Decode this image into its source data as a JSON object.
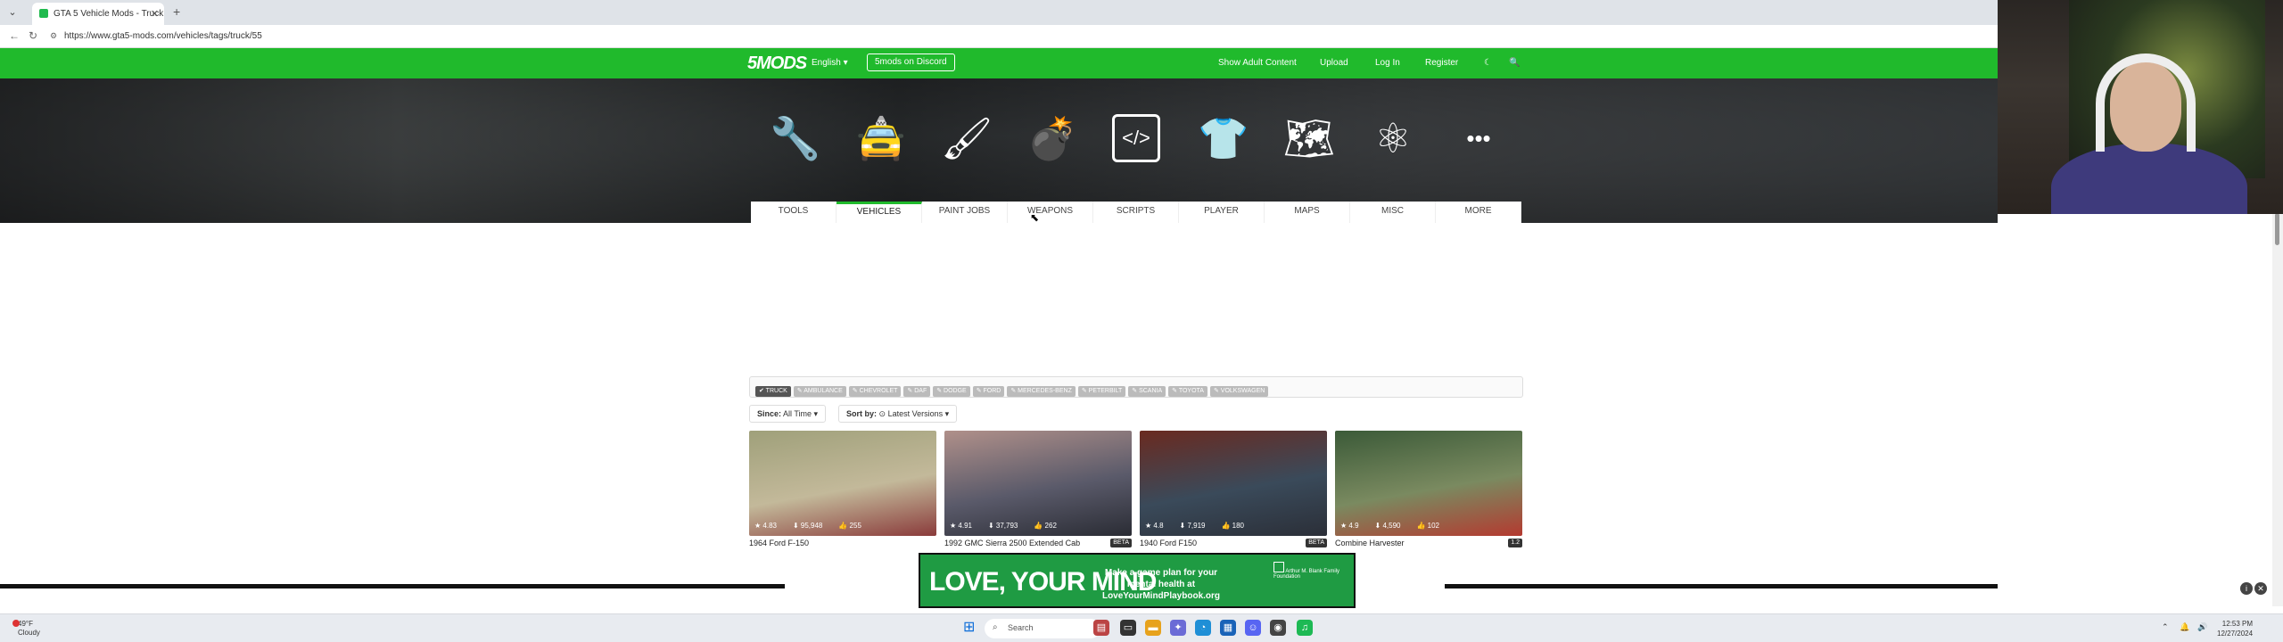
{
  "browser": {
    "tab_title": "GTA 5 Vehicle Mods - Truck - GTA5-",
    "tab_close": "✕",
    "new_tab": "+",
    "url": "https://www.gta5-mods.com/vehicles/tags/truck/55",
    "back": "←",
    "reload": "↻",
    "tab_menu": "⌄"
  },
  "navbar": {
    "logo": "5MODS",
    "language": "English ▾",
    "discord": "5mods on Discord",
    "show_adult": "Show Adult Content",
    "upload": "Upload",
    "login": "Log In",
    "register": "Register",
    "dark_mode_icon": "☾",
    "search_icon": "🔍"
  },
  "categories": [
    {
      "label": "TOOLS",
      "icon": "wrench-screwdriver-icon",
      "glyph": "🔧"
    },
    {
      "label": "VEHICLES",
      "icon": "car-icon",
      "glyph": "🚖",
      "active": true
    },
    {
      "label": "PAINT JOBS",
      "icon": "paint-roller-icon",
      "glyph": "🖌"
    },
    {
      "label": "WEAPONS",
      "icon": "grenade-icon",
      "glyph": "💣"
    },
    {
      "label": "SCRIPTS",
      "icon": "code-icon",
      "glyph": "</>"
    },
    {
      "label": "PLAYER",
      "icon": "hoodie-icon",
      "glyph": "👕"
    },
    {
      "label": "MAPS",
      "icon": "map-icon",
      "glyph": "🗺"
    },
    {
      "label": "MISC",
      "icon": "atom-icon",
      "glyph": "⚛"
    },
    {
      "label": "MORE",
      "icon": "more-dots-icon",
      "glyph": "•••"
    }
  ],
  "filters": [
    "✔ TRUCK",
    "✎ AMBULANCE",
    "✎ CHEVROLET",
    "✎ DAF",
    "✎ DODGE",
    "✎ FORD",
    "✎ MERCEDES-BENZ",
    "✎ PETERBILT",
    "✎ SCANIA",
    "✎ TOYOTA",
    "✎ VOLKSWAGEN"
  ],
  "sort": {
    "since_label": "Since:",
    "since_value": "All Time ▾",
    "sort_label": "Sort by:",
    "sort_value": "⊙ Latest Versions ▾"
  },
  "cards": [
    {
      "title": "1964 Ford F-150",
      "rating": "★ 4.83",
      "downloads": "⬇ 95,948",
      "likes": "👍 255",
      "badge": "",
      "colors": [
        "#9fa07a",
        "#c3b99a",
        "#8a3b3b"
      ]
    },
    {
      "title": "1992 GMC Sierra 2500 Extended Cab",
      "rating": "★ 4.91",
      "downloads": "⬇ 37,793",
      "likes": "👍 262",
      "badge": "BETA",
      "colors": [
        "#b0908a",
        "#5a5a6a",
        "#2a2c34"
      ]
    },
    {
      "title": "1940 Ford F150",
      "rating": "★ 4.8",
      "downloads": "⬇ 7,919",
      "likes": "👍 180",
      "badge": "BETA",
      "colors": [
        "#6a2a20",
        "#3a4a5a",
        "#2b2f38"
      ]
    },
    {
      "title": "Combine Harvester",
      "rating": "★ 4.9",
      "downloads": "⬇ 4,590",
      "likes": "👍 102",
      "badge": "1.2",
      "colors": [
        "#3b5a38",
        "#7a8a60",
        "#b43a30"
      ]
    }
  ],
  "ad": {
    "headline": "LOVE, YOUR MIND",
    "tagline": "Make a game plan for your mental health at LoveYourMindPlaybook.org",
    "sponsor": "Arthur M. Blank Family Foundation"
  },
  "taskbar": {
    "weather_temp": "49°F",
    "weather_desc": "Cloudy",
    "search": "Search",
    "time": "12:53 PM",
    "date": "12/27/2024"
  }
}
